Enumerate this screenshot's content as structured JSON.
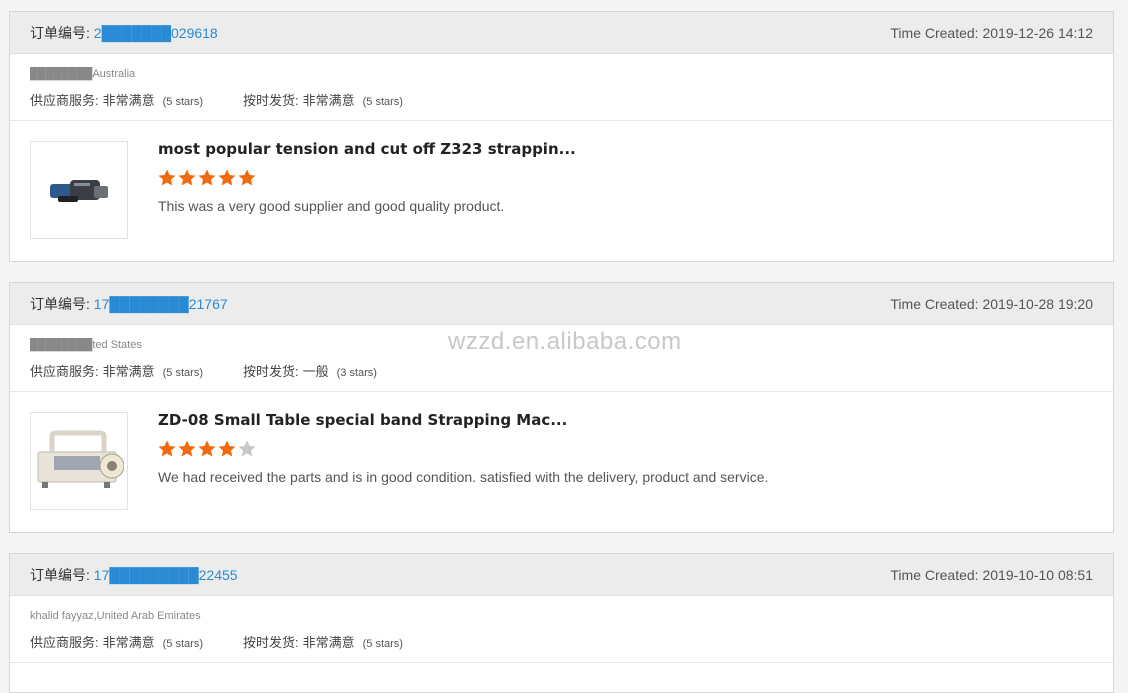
{
  "watermark": "wzzd.en.alibaba.com",
  "colors": {
    "accent": "#2a8ad4",
    "star_on": "#f26a10",
    "star_off": "#c8c8c8",
    "redaction": "#ff1a1a"
  },
  "orders": [
    {
      "order_label": "订单编号:",
      "order_no": "2███████029618",
      "time_created": "Time Created: 2019-12-26 14:12",
      "buyer": "████████Australia",
      "supplier_service_label": "供应商服务:",
      "supplier_service_value": "非常满意",
      "supplier_service_stars": "(5 stars)",
      "shipping_label": "按时发货:",
      "shipping_value": "非常满意",
      "shipping_stars": "(5 stars)",
      "product_title": "most popular tension and cut off Z323 strappin...",
      "rating": 5,
      "comment": "This was a very good supplier and good quality product.",
      "thumb_icon": "battery-strapping-tool-image"
    },
    {
      "order_label": "订单编号:",
      "order_no": "17████████21767",
      "time_created": "Time Created: 2019-10-28 19:20",
      "buyer": "████████ted States",
      "supplier_service_label": "供应商服务:",
      "supplier_service_value": "非常满意",
      "supplier_service_stars": "(5 stars)",
      "shipping_label": "按时发货:",
      "shipping_value": "一般",
      "shipping_stars": "(3 stars)",
      "product_title": "ZD-08 Small Table special band Strapping Mac...",
      "rating": 4,
      "comment": "We had received the parts and is in good condition. satisfied with the delivery, product and service.",
      "thumb_icon": "table-strapping-machine-image"
    },
    {
      "order_label": "订单编号:",
      "order_no": "17█████████22455",
      "time_created": "Time Created: 2019-10-10 08:51",
      "buyer": "khalid fayyaz,United Arab Emirates",
      "supplier_service_label": "供应商服务:",
      "supplier_service_value": "非常满意",
      "supplier_service_stars": "(5 stars)",
      "shipping_label": "按时发货:",
      "shipping_value": "非常满意",
      "shipping_stars": "(5 stars)"
    }
  ]
}
